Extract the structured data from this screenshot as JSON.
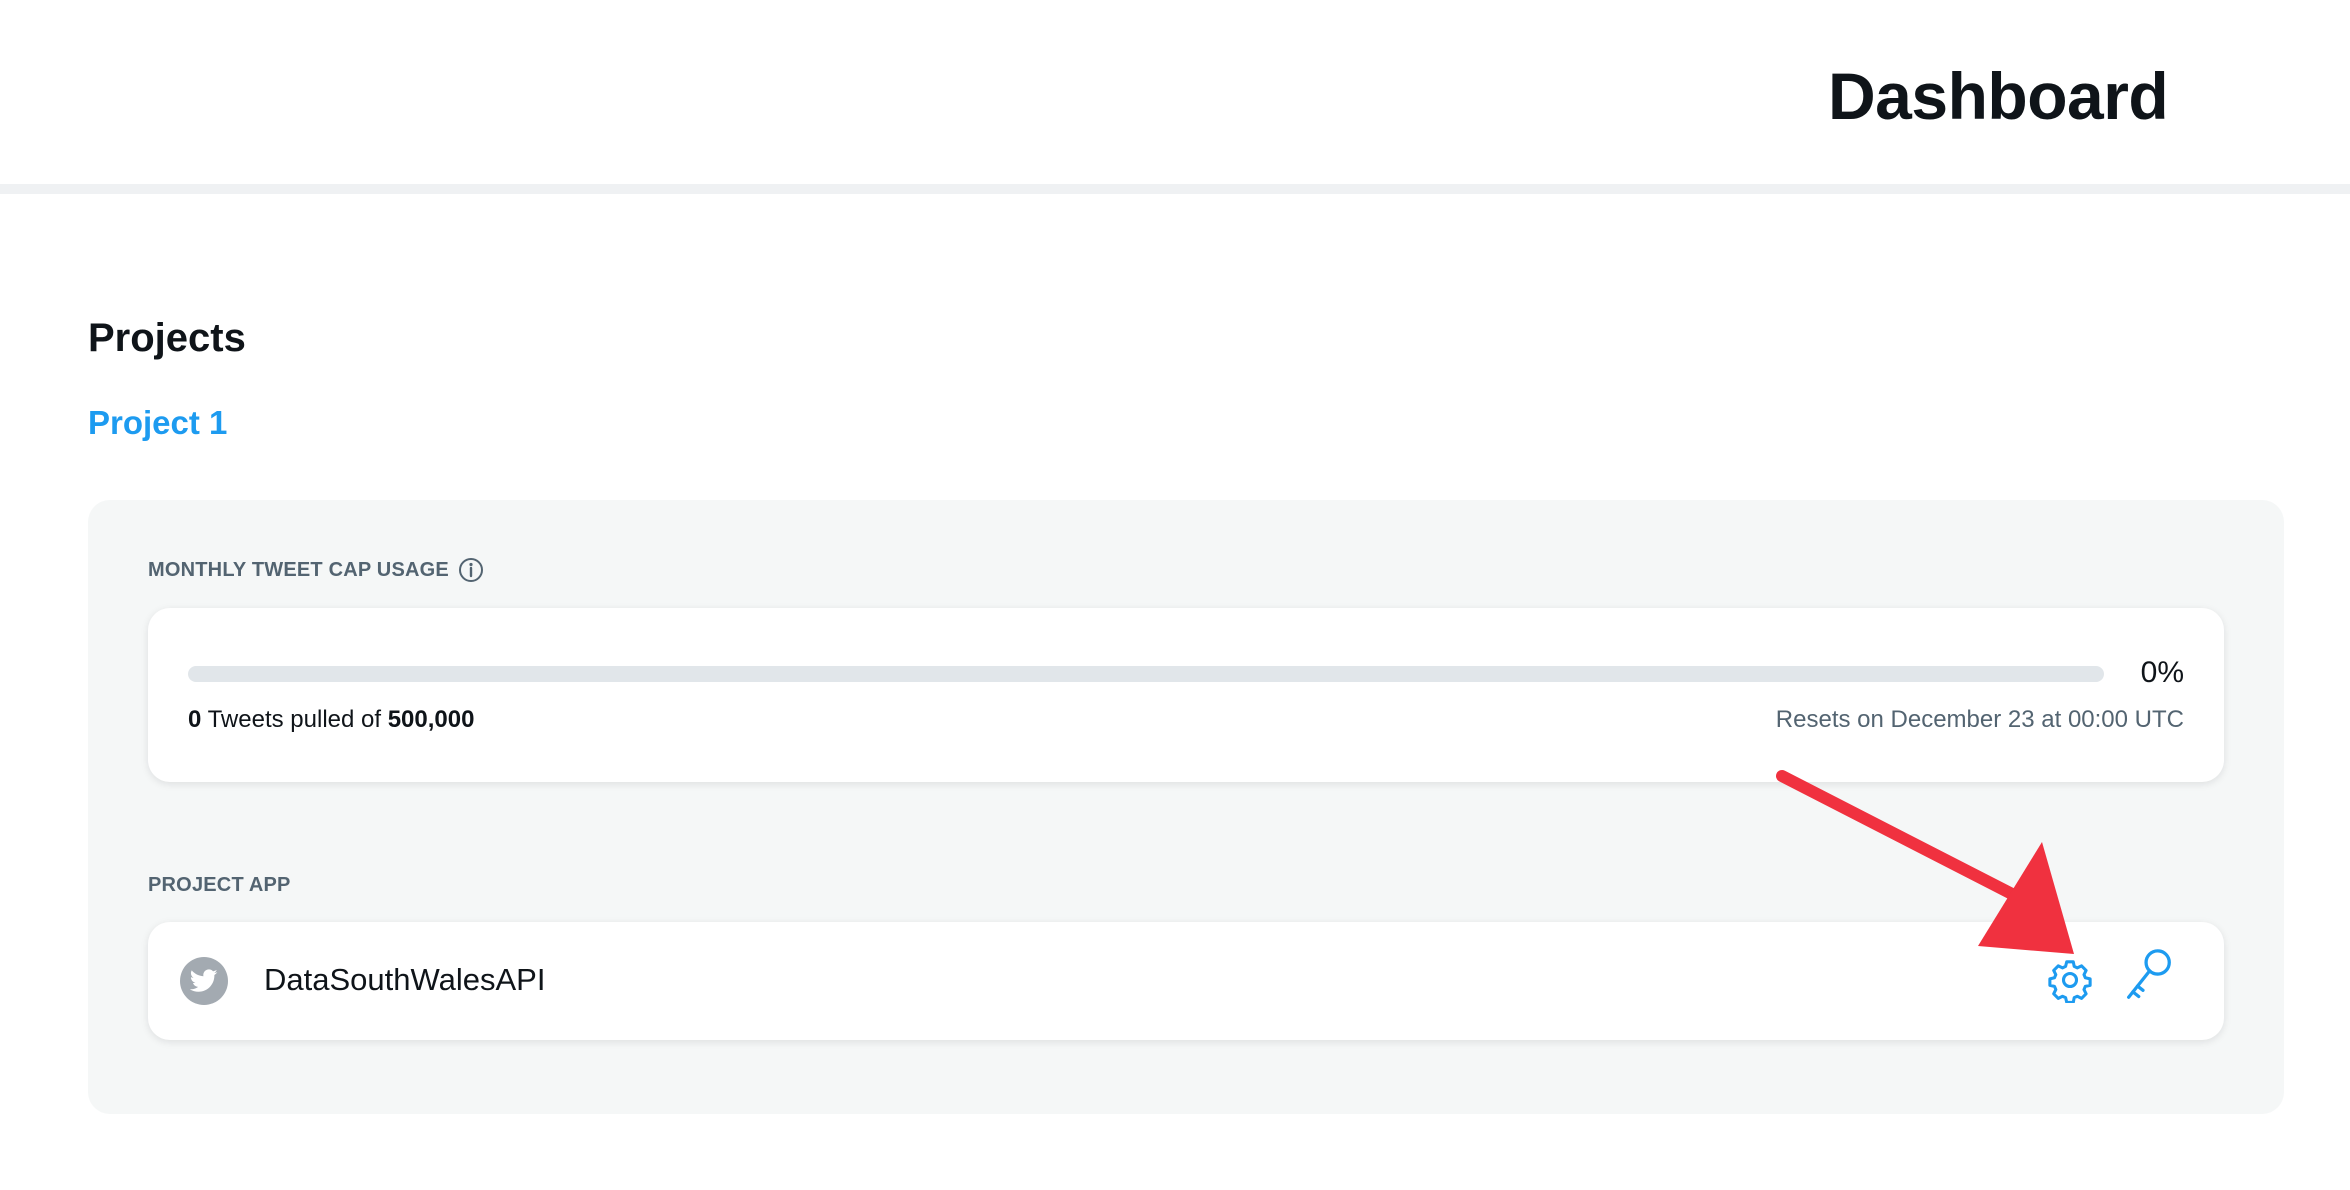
{
  "header": {
    "title": "Dashboard"
  },
  "projects": {
    "heading": "Projects",
    "project_name": "Project 1",
    "usage": {
      "label": "MONTHLY TWEET CAP USAGE",
      "percent_text": "0%",
      "progress_fraction": 0,
      "pulled": "0",
      "pulled_text": "Tweets pulled of",
      "cap": "500,000",
      "resets": "Resets on December 23 at 00:00 UTC"
    },
    "app": {
      "label": "PROJECT APP",
      "name": "DataSouthWalesAPI",
      "avatar_icon": "twitter-bird-icon",
      "actions": [
        "gear-icon",
        "key-icon"
      ]
    }
  },
  "colors": {
    "accent": "#1d9bf0",
    "annotation": "#f0313f",
    "panel": "#f5f7f7"
  }
}
